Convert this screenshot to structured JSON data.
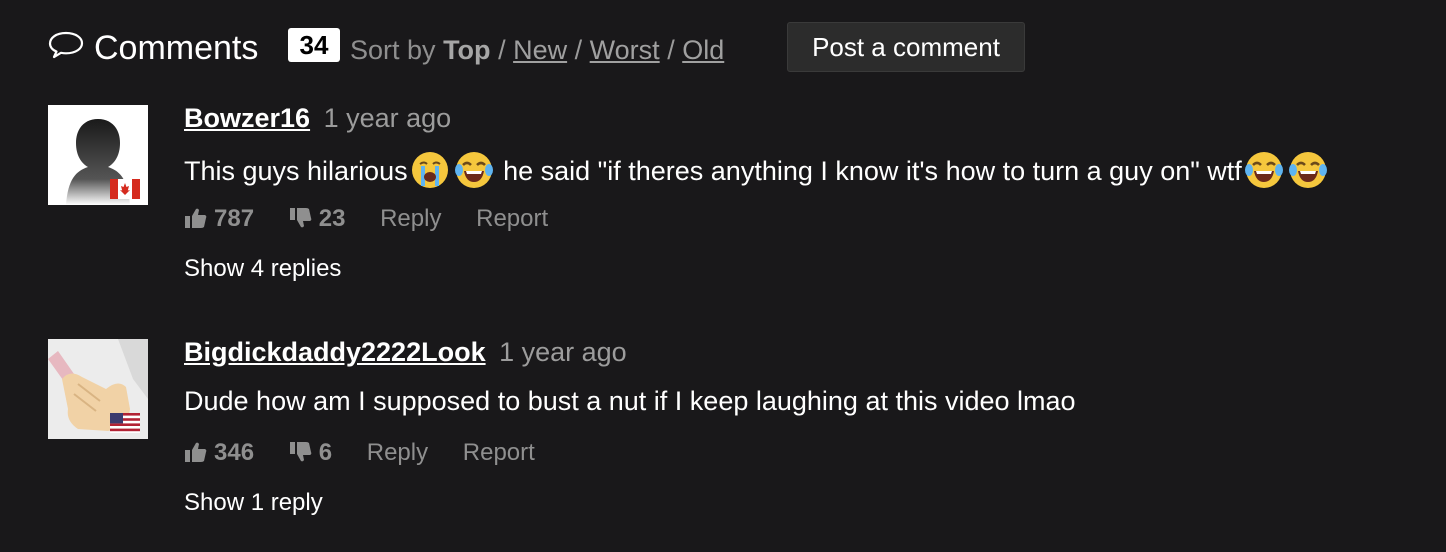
{
  "header": {
    "title": "Comments",
    "count": "34",
    "sort_prefix": "Sort by",
    "sort_options": [
      "Top",
      "New",
      "Worst",
      "Old"
    ],
    "sort_separator": "/",
    "post_button": "Post a comment"
  },
  "comments": [
    {
      "username": "Bowzer16",
      "time": "1 year ago",
      "text_parts": [
        "This guys hilarious",
        " he said \"if theres anything I know it's how to turn a guy on\" wtf"
      ],
      "likes": "787",
      "dislikes": "23",
      "reply_label": "Reply",
      "report_label": "Report",
      "show_replies": "Show 4 replies",
      "flag": "canada-flag-icon"
    },
    {
      "username": "Bigdickdaddy2222Look",
      "time": "1 year ago",
      "text": "Dude how am I supposed to bust a nut if I keep laughing at this video lmao",
      "likes": "346",
      "dislikes": "6",
      "reply_label": "Reply",
      "report_label": "Report",
      "show_replies": "Show 1 reply",
      "flag": "usa-flag-icon"
    }
  ],
  "colors": {
    "background": "#19181a",
    "muted_text": "#8f8f8f",
    "badge_bg": "#ffffff",
    "button_bg": "#2c2c2c"
  }
}
